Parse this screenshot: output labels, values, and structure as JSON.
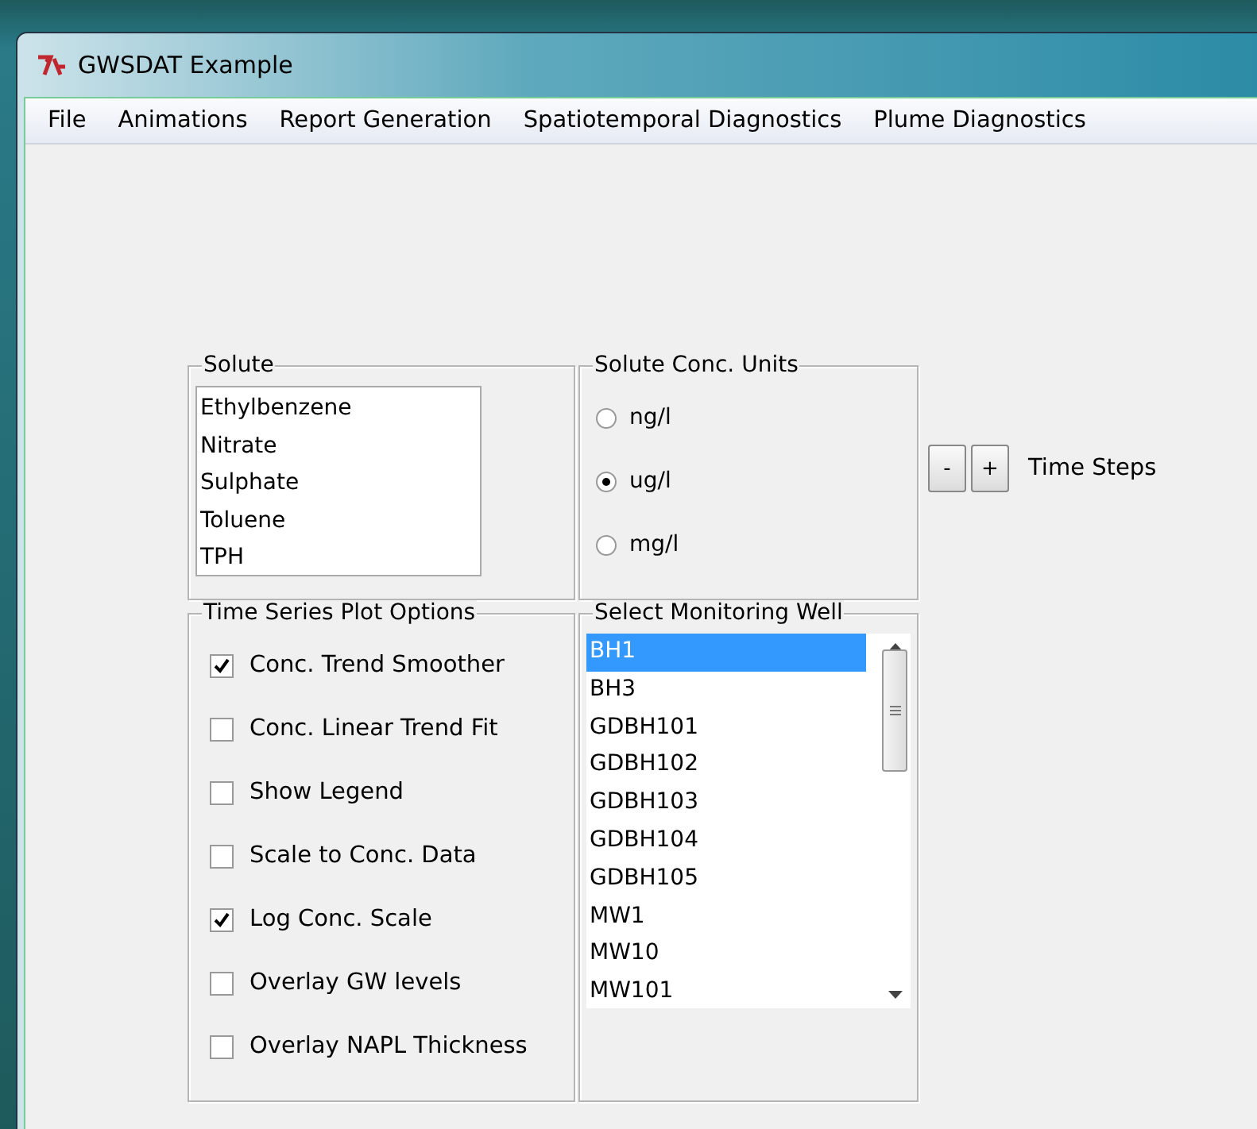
{
  "window": {
    "title": "GWSDAT Example"
  },
  "menu": [
    "File",
    "Animations",
    "Report Generation",
    "Spatiotemporal Diagnostics",
    "Plume Diagnostics"
  ],
  "solute": {
    "title": "Solute",
    "items": [
      "Ethylbenzene",
      "Nitrate",
      "Sulphate",
      "Toluene",
      "TPH"
    ]
  },
  "units": {
    "title": "Solute Conc. Units",
    "options": [
      {
        "label": "ng/l",
        "selected": false
      },
      {
        "label": "ug/l",
        "selected": true
      },
      {
        "label": "mg/l",
        "selected": false
      }
    ]
  },
  "time_steps": {
    "buttons": [
      "-",
      "+"
    ],
    "label": "Time Steps"
  },
  "plot_options": {
    "title": "Time Series Plot Options",
    "options": [
      {
        "label": "Conc. Trend Smoother",
        "checked": true
      },
      {
        "label": "Conc. Linear Trend Fit",
        "checked": false
      },
      {
        "label": "Show Legend",
        "checked": false
      },
      {
        "label": "Scale to Conc. Data",
        "checked": false
      },
      {
        "label": "Log Conc. Scale",
        "checked": true
      },
      {
        "label": "Overlay GW levels",
        "checked": false
      },
      {
        "label": "Overlay NAPL Thickness",
        "checked": false
      }
    ]
  },
  "wells": {
    "title": "Select Monitoring Well",
    "items": [
      {
        "label": "BH1",
        "selected": true
      },
      {
        "label": "BH3",
        "selected": false
      },
      {
        "label": "GDBH101",
        "selected": false
      },
      {
        "label": "GDBH102",
        "selected": false
      },
      {
        "label": "GDBH103",
        "selected": false
      },
      {
        "label": "GDBH104",
        "selected": false
      },
      {
        "label": "GDBH105",
        "selected": false
      },
      {
        "label": "MW1",
        "selected": false
      },
      {
        "label": "MW10",
        "selected": false
      },
      {
        "label": "MW101",
        "selected": false
      }
    ]
  }
}
